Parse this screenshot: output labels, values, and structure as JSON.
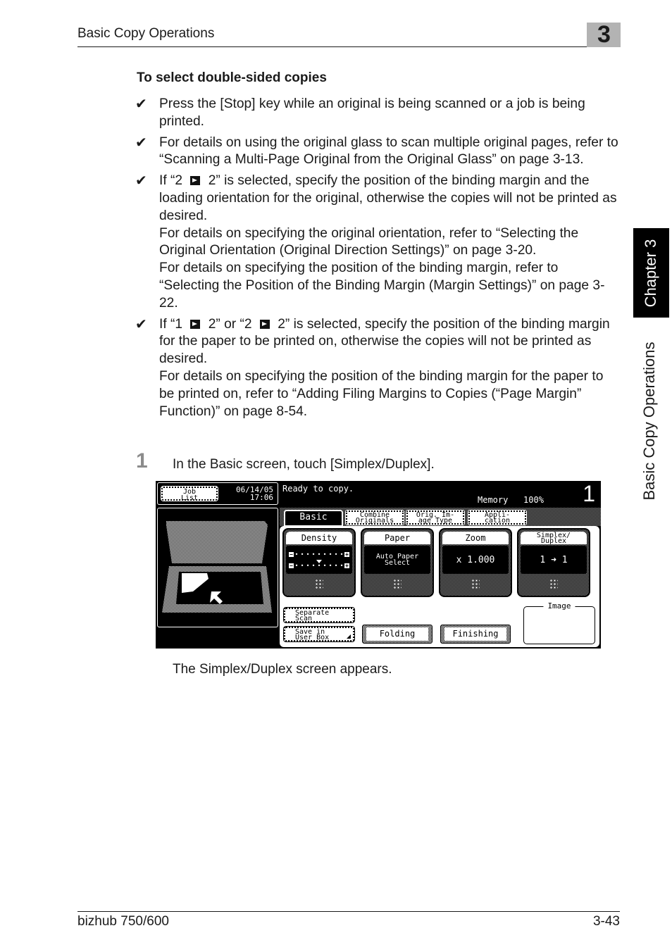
{
  "header": {
    "section_title": "Basic Copy Operations",
    "chapter_number": "3"
  },
  "side_tab": {
    "chapter_label": "Chapter 3",
    "section_label": "Basic Copy Operations"
  },
  "content": {
    "title": "To select double-sided copies",
    "bullets": [
      {
        "icon": "check-icon",
        "lines": [
          "Press the [Stop] key while an original is being scanned or a job is being printed."
        ]
      },
      {
        "icon": "check-icon",
        "lines": [
          "For details on using the original glass to scan multiple original pages, refer to “Scanning a Multi-Page Original from the Original Glass” on page 3-13."
        ]
      },
      {
        "icon": "check-icon",
        "pre": "If “2 ",
        "post": " 2” is selected, specify the position of the binding margin and the loading orientation for the original, otherwise the copies will not be printed as desired.",
        "extra": [
          "For details on specifying the original orientation, refer to “Selecting the Original Orientation (Original Direction Settings)” on page 3-20.",
          "For details on specifying the position of the binding margin, refer to “Selecting the Position of the Binding Margin (Margin Settings)” on page 3-22."
        ]
      },
      {
        "icon": "check-icon",
        "pre": "If “1 ",
        "mid": " 2” or “2 ",
        "post": " 2” is selected, specify the position of the binding margin for the paper to be printed on, otherwise the copies will not be printed as desired.",
        "extra": [
          "For details on specifying the position of the binding margin for the paper to be printed on, refer to “Adding Filing Margins to Copies (“Page Margin” Function)” on page 8-54."
        ]
      }
    ],
    "step": {
      "number": "1",
      "text": "In the Basic screen, touch [Simplex/Duplex]."
    },
    "result": "The Simplex/Duplex screen appears."
  },
  "panel": {
    "job_list_button": "Job\nList",
    "date": "06/14/05",
    "time": "17:06",
    "status": "Ready to copy.",
    "memory_label": "Memory",
    "memory_value": "100%",
    "copies": "1",
    "tabs": [
      {
        "label": "Basic",
        "active": true
      },
      {
        "label": "Combine\nOriginals",
        "active": false
      },
      {
        "label": "Orig. Im-\nage Type",
        "active": false
      },
      {
        "label": "Appli-\ncation",
        "active": false
      }
    ],
    "functions": {
      "density": {
        "title": "Density",
        "level_steps": 9,
        "level_index": 4
      },
      "paper": {
        "title": "Paper",
        "value": "Auto Paper\nSelect"
      },
      "zoom": {
        "title": "Zoom",
        "value": "x 1.000"
      },
      "duplex": {
        "title": "Simplex/\nDuplex",
        "value": "1 ➜ 1"
      }
    },
    "buttons": {
      "separate_scan": "Separate\nScan",
      "save_user_box": "Save in\nUser Box",
      "folding": "Folding",
      "finishing": "Finishing"
    },
    "image_label": "Image"
  },
  "footer": {
    "model": "bizhub 750/600",
    "page": "3-43"
  }
}
